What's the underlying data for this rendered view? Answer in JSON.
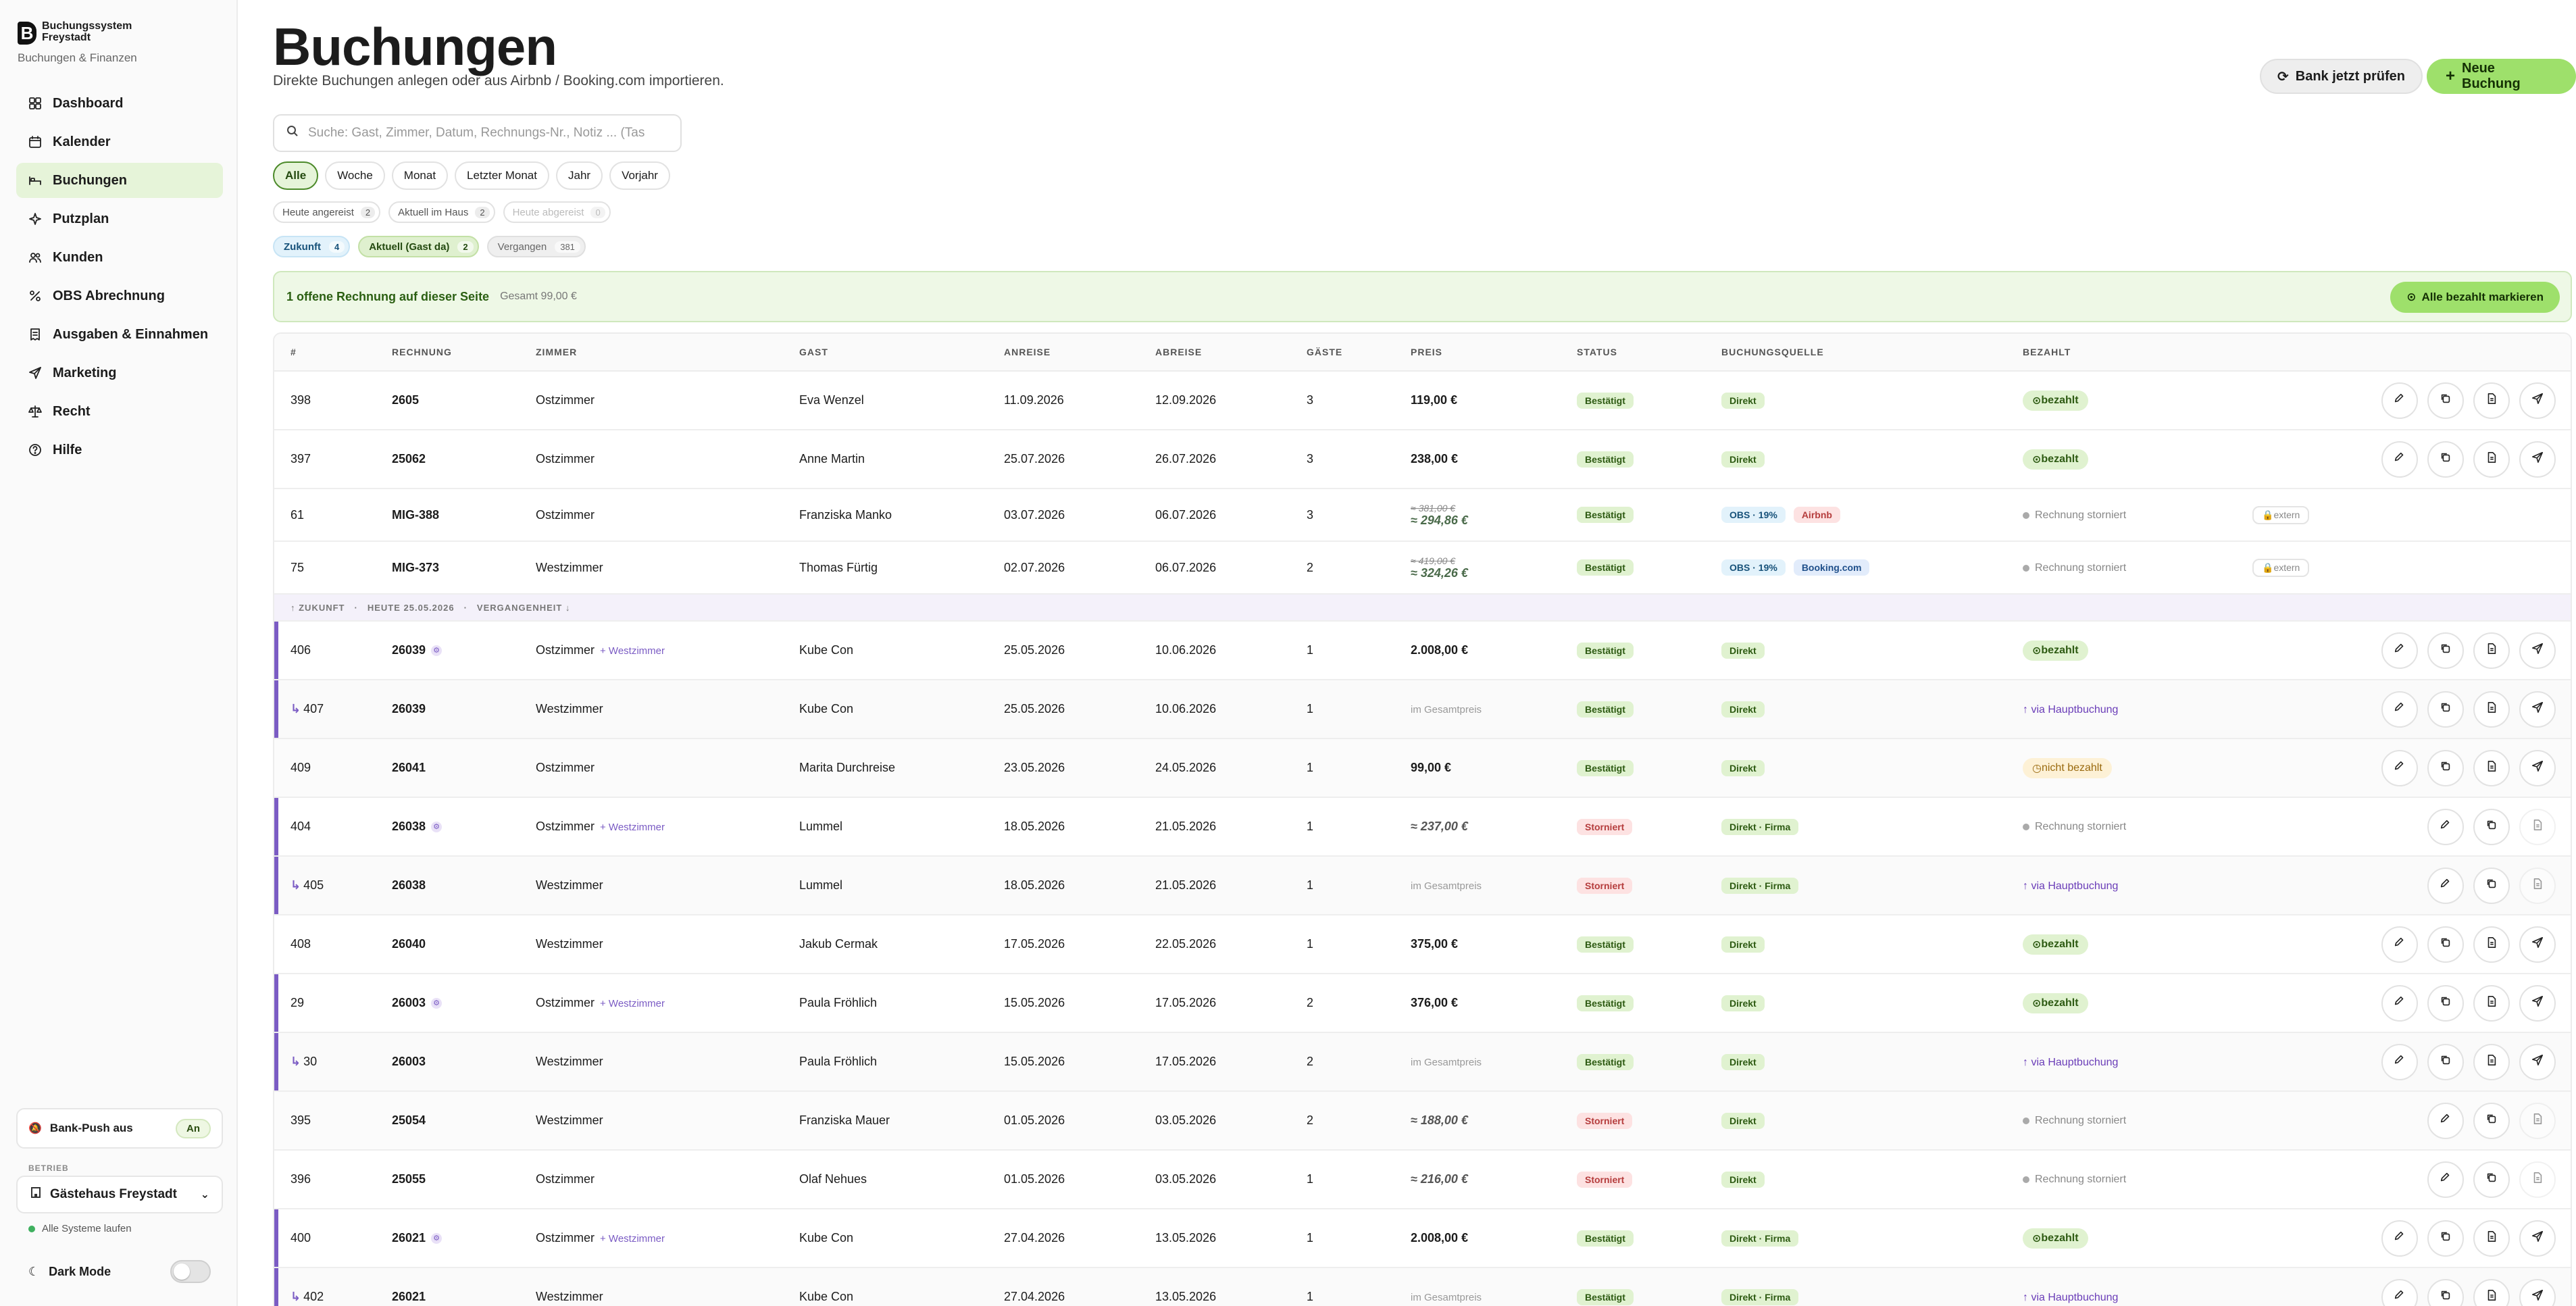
{
  "brand": {
    "name": "Buchungssystem Freystadt",
    "sub": "Buchungen & Finanzen",
    "mark": "B"
  },
  "nav": [
    {
      "label": "Dashboard",
      "icon": "dashboard-icon"
    },
    {
      "label": "Kalender",
      "icon": "calendar-icon"
    },
    {
      "label": "Buchungen",
      "icon": "bed-icon",
      "active": true
    },
    {
      "label": "Putzplan",
      "icon": "sparkle-icon"
    },
    {
      "label": "Kunden",
      "icon": "users-icon"
    },
    {
      "label": "OBS Abrechnung",
      "icon": "percent-icon"
    },
    {
      "label": "Ausgaben & Einnahmen",
      "icon": "receipt-icon"
    },
    {
      "label": "Marketing",
      "icon": "send-icon"
    },
    {
      "label": "Recht",
      "icon": "scale-icon"
    },
    {
      "label": "Hilfe",
      "icon": "help-icon"
    }
  ],
  "sidebar_footer": {
    "bankpush_label": "Bank-Push aus",
    "bankpush_toggle": "An",
    "betrieb_label": "BETRIEB",
    "betrieb_value": "Gästehaus Freystadt",
    "systems": "Alle Systeme laufen",
    "darkmode": "Dark Mode"
  },
  "header": {
    "title": "Buchungen",
    "subtitle": "Direkte Buchungen anlegen oder aus Airbnb / Booking.com importieren.",
    "bank_button": "Bank jetzt prüfen",
    "new_button": "Neue Buchung"
  },
  "search": {
    "placeholder": "Suche: Gast, Zimmer, Datum, Rechnungs-Nr., Notiz ... (Tas"
  },
  "period_filters": [
    "Alle",
    "Woche",
    "Monat",
    "Letzter Monat",
    "Jahr",
    "Vorjahr"
  ],
  "count_filters": [
    {
      "label": "Heute angereist",
      "n": "2"
    },
    {
      "label": "Aktuell im Haus",
      "n": "2"
    },
    {
      "label": "Heute abgereist",
      "n": "0"
    }
  ],
  "status_filters": [
    {
      "label": "Zukunft",
      "n": "4"
    },
    {
      "label": "Aktuell (Gast da)",
      "n": "2"
    },
    {
      "label": "Vergangen",
      "n": "381"
    }
  ],
  "open_banner": {
    "text": "1 offene Rechnung auf dieser Seite",
    "total": "Gesamt 99,00 €",
    "button": "Alle bezahlt markieren"
  },
  "table": {
    "headers": [
      "#",
      "RECHNUNG",
      "ZIMMER",
      "GAST",
      "ANREISE",
      "ABREISE",
      "GÄSTE",
      "PREIS",
      "STATUS",
      "BUCHUNGSQUELLE",
      "BEZAHLT"
    ],
    "separator": [
      "↑ ZUKUNFT",
      "·",
      "HEUTE 25.05.2026",
      "·",
      "VERGANGENHEIT ↓"
    ],
    "rows_a": [
      {
        "id": "398",
        "inv": "2605",
        "room": "Ostzimmer",
        "guest": "Eva Wenzel",
        "in": "11.09.2026",
        "out": "12.09.2026",
        "g": "3",
        "price": "119,00 €",
        "status": "Bestätigt",
        "src": [
          "Direkt"
        ],
        "paid": "bezahlt"
      },
      {
        "id": "397",
        "inv": "25062",
        "room": "Ostzimmer",
        "guest": "Anne Martin",
        "in": "25.07.2026",
        "out": "26.07.2026",
        "g": "3",
        "price": "238,00 €",
        "status": "Bestätigt",
        "src": [
          "Direkt"
        ],
        "paid": "bezahlt"
      },
      {
        "id": "61",
        "inv": "MIG-388",
        "room": "Ostzimmer",
        "guest": "Franziska Manko",
        "in": "03.07.2026",
        "out": "06.07.2026",
        "g": "3",
        "old": "≈ 381,00 €",
        "price": "≈ 294,86 €",
        "status": "Bestätigt",
        "src": [
          "OBS · 19%",
          "Airbnb"
        ],
        "paid": "Rechnung storniert",
        "extern": "extern"
      },
      {
        "id": "75",
        "inv": "MIG-373",
        "room": "Westzimmer",
        "guest": "Thomas Fürtig",
        "in": "02.07.2026",
        "out": "06.07.2026",
        "g": "2",
        "old": "≈ 419,00 €",
        "price": "≈ 324,26 €",
        "status": "Bestätigt",
        "src": [
          "OBS · 19%",
          "Booking.com"
        ],
        "paid": "Rechnung storniert",
        "extern": "extern"
      }
    ],
    "rows_b": [
      {
        "id": "406",
        "inv": "26039",
        "room": "Ostzimmer",
        "plus": "+ Westzimmer",
        "guest": "Kube Con",
        "in": "25.05.2026",
        "out": "10.06.2026",
        "g": "1",
        "price": "2.008,00 €",
        "status": "Bestätigt",
        "src": "Direkt",
        "paid": "bezahlt"
      },
      {
        "id": "407",
        "inv": "26039",
        "room": "Westzimmer",
        "guest": "Kube Con",
        "in": "25.05.2026",
        "out": "10.06.2026",
        "g": "1",
        "price": "im Gesamtpreis",
        "status": "Bestätigt",
        "src": "Direkt",
        "paid": "↑ via Hauptbuchung"
      },
      {
        "id": "409",
        "inv": "26041",
        "room": "Ostzimmer",
        "guest": "Marita Durchreise",
        "in": "23.05.2026",
        "out": "24.05.2026",
        "g": "1",
        "price": "99,00 €",
        "status": "Bestätigt",
        "src": "Direkt",
        "paid": "nicht bezahlt"
      },
      {
        "id": "404",
        "inv": "26038",
        "room": "Ostzimmer",
        "plus": "+ Westzimmer",
        "guest": "Lummel",
        "in": "18.05.2026",
        "out": "21.05.2026",
        "g": "1",
        "price": "≈ 237,00 €",
        "status": "Storniert",
        "src": "Direkt · Firma",
        "paid": "Rechnung storniert"
      },
      {
        "id": "405",
        "inv": "26038",
        "room": "Westzimmer",
        "guest": "Lummel",
        "in": "18.05.2026",
        "out": "21.05.2026",
        "g": "1",
        "price": "im Gesamtpreis",
        "status": "Storniert",
        "src": "Direkt · Firma",
        "paid": "↑ via Hauptbuchung"
      },
      {
        "id": "408",
        "inv": "26040",
        "room": "Westzimmer",
        "guest": "Jakub Cermak",
        "in": "17.05.2026",
        "out": "22.05.2026",
        "g": "1",
        "price": "375,00 €",
        "status": "Bestätigt",
        "src": "Direkt",
        "paid": "bezahlt"
      },
      {
        "id": "29",
        "inv": "26003",
        "room": "Ostzimmer",
        "plus": "+ Westzimmer",
        "guest": "Paula Fröhlich",
        "in": "15.05.2026",
        "out": "17.05.2026",
        "g": "2",
        "price": "376,00 €",
        "status": "Bestätigt",
        "src": "Direkt",
        "paid": "bezahlt"
      },
      {
        "id": "30",
        "inv": "26003",
        "room": "Westzimmer",
        "guest": "Paula Fröhlich",
        "in": "15.05.2026",
        "out": "17.05.2026",
        "g": "2",
        "price": "im Gesamtpreis",
        "status": "Bestätigt",
        "src": "Direkt",
        "paid": "↑ via Hauptbuchung"
      },
      {
        "id": "395",
        "inv": "25054",
        "room": "Westzimmer",
        "guest": "Franziska Mauer",
        "in": "01.05.2026",
        "out": "03.05.2026",
        "g": "2",
        "price": "≈ 188,00 €",
        "status": "Storniert",
        "src": "Direkt",
        "paid": "Rechnung storniert"
      },
      {
        "id": "396",
        "inv": "25055",
        "room": "Ostzimmer",
        "guest": "Olaf Nehues",
        "in": "01.05.2026",
        "out": "03.05.2026",
        "g": "1",
        "price": "≈ 216,00 €",
        "status": "Storniert",
        "src": "Direkt",
        "paid": "Rechnung storniert"
      },
      {
        "id": "400",
        "inv": "26021",
        "room": "Ostzimmer",
        "plus": "+ Westzimmer",
        "guest": "Kube Con",
        "in": "27.04.2026",
        "out": "13.05.2026",
        "g": "1",
        "price": "2.008,00 €",
        "status": "Bestätigt",
        "src": "Direkt · Firma",
        "paid": "bezahlt"
      },
      {
        "id": "402",
        "inv": "26021",
        "room": "Westzimmer",
        "guest": "Kube Con",
        "in": "27.04.2026",
        "out": "13.05.2026",
        "g": "1",
        "price": "im Gesamtpreis",
        "status": "Bestätigt",
        "src": "Direkt · Firma",
        "paid": "↑ via Hauptbuchung"
      }
    ]
  },
  "colors": {
    "accent": "#9ee06b",
    "active_nav": "#e6f4d9",
    "group_bar": "#7b5cc4"
  }
}
